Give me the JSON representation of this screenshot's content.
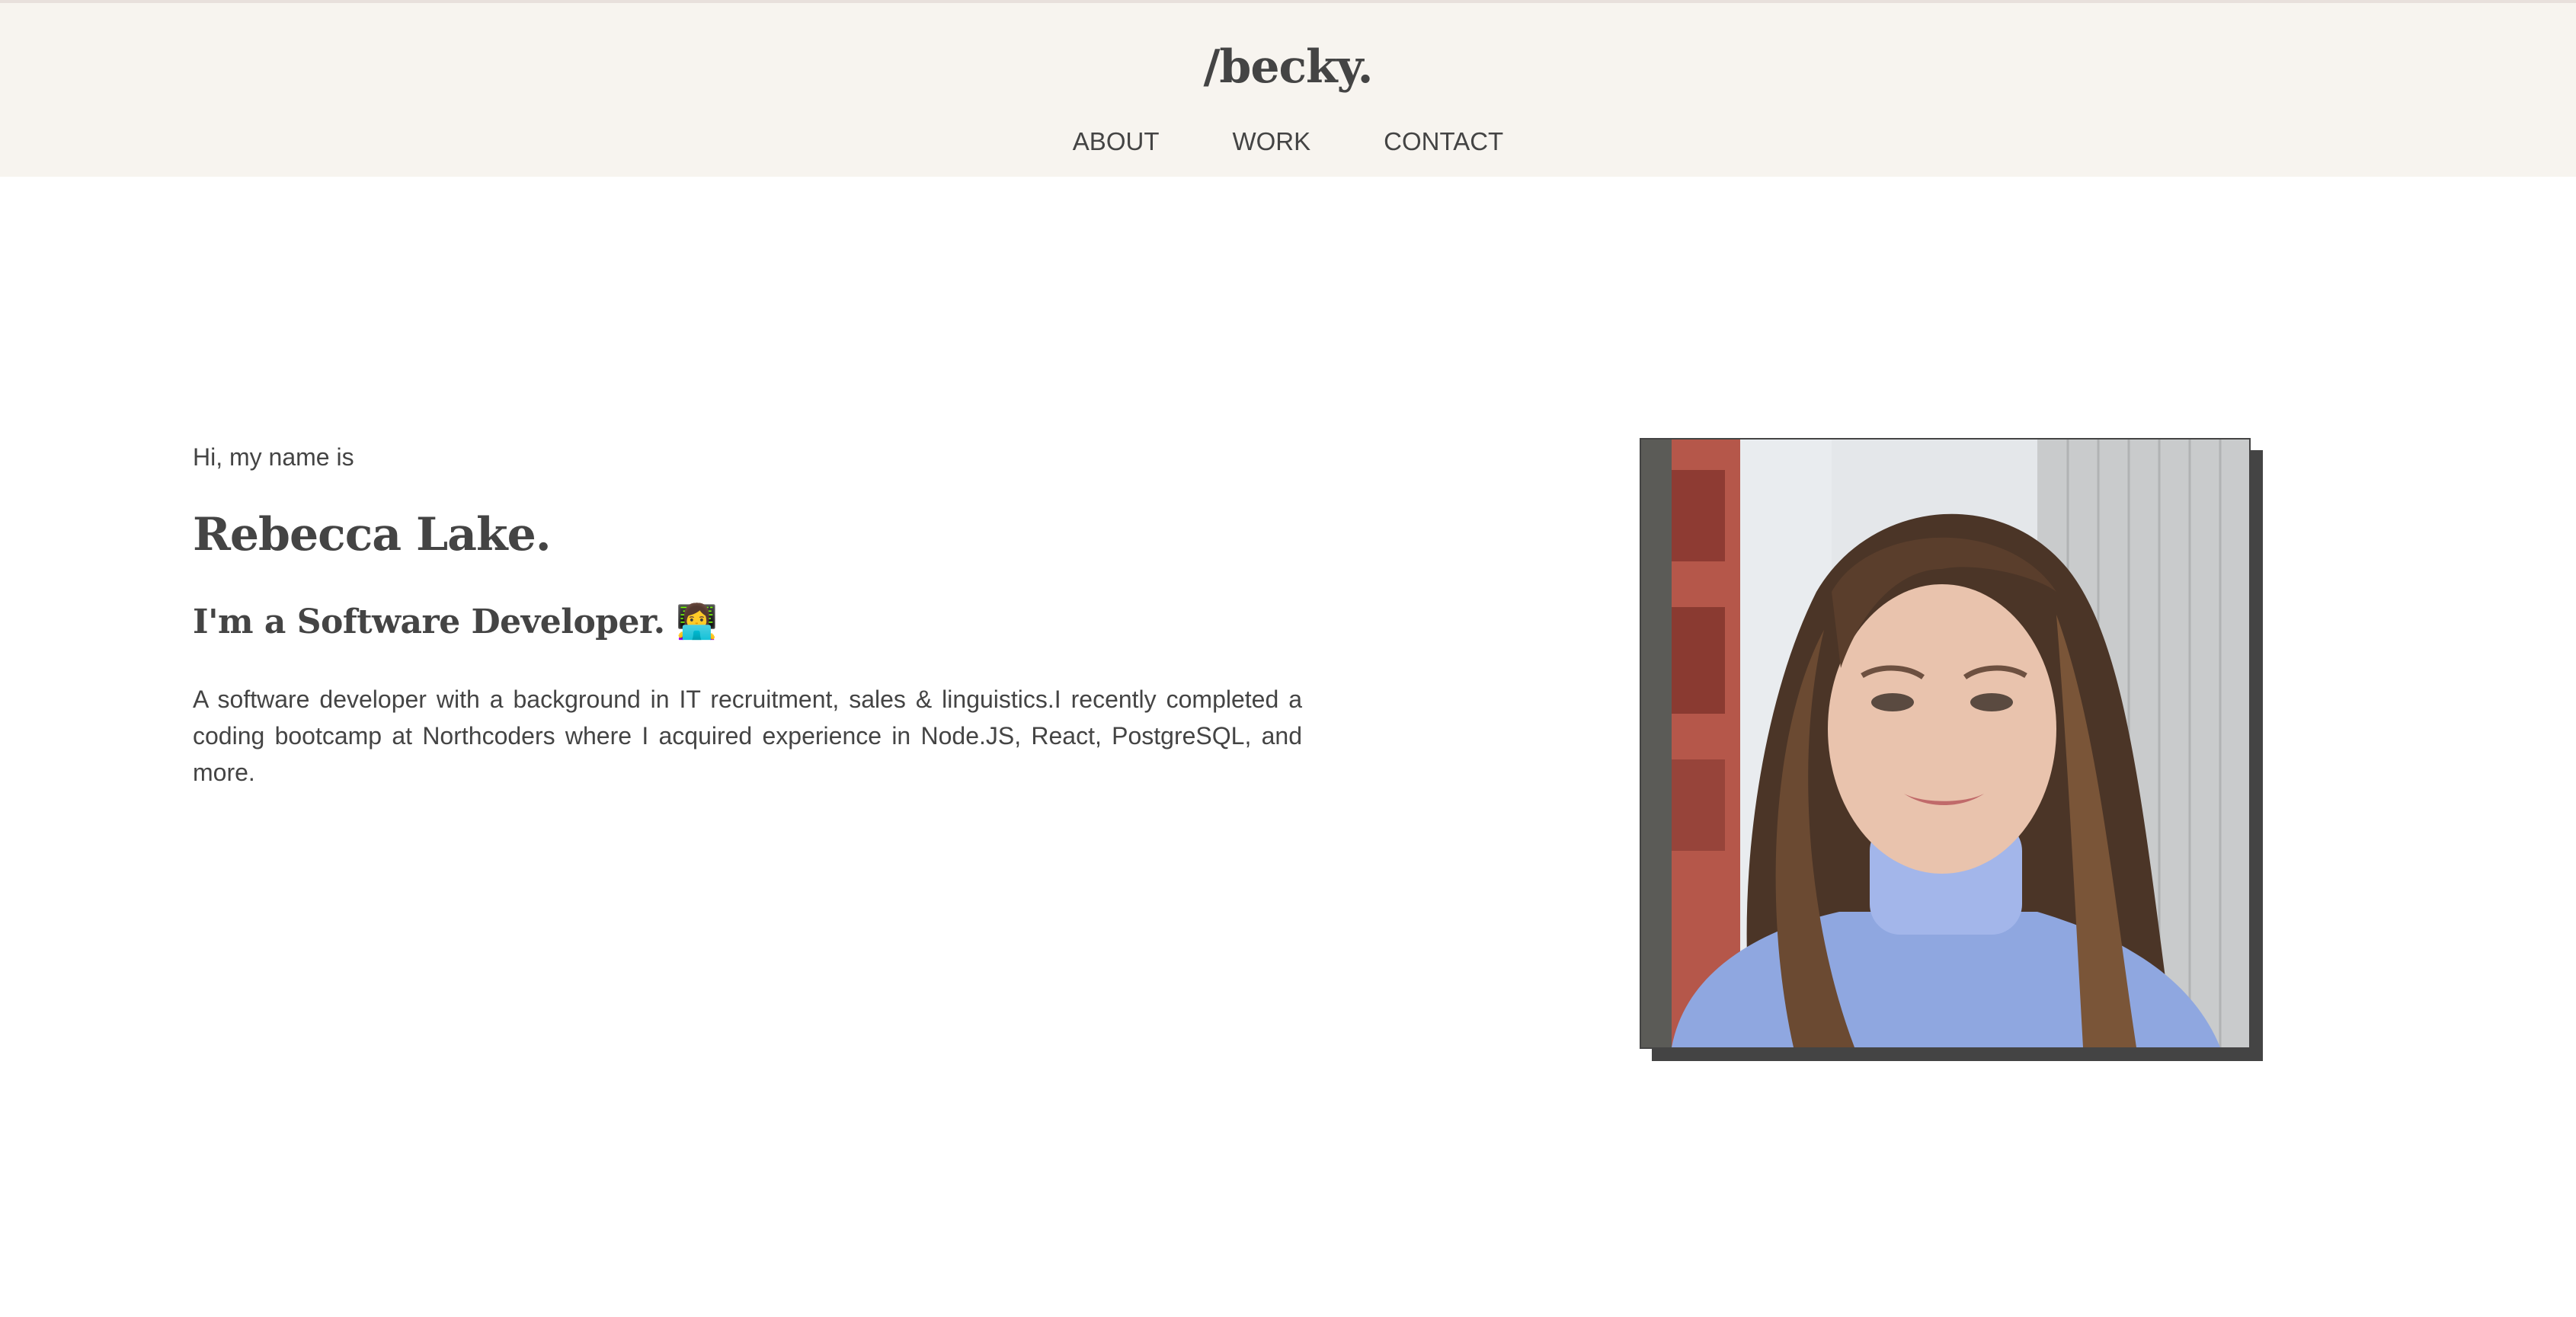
{
  "header": {
    "site_title": "/becky.",
    "nav": [
      {
        "label": "ABOUT"
      },
      {
        "label": "WORK"
      },
      {
        "label": "CONTACT"
      }
    ]
  },
  "intro": {
    "greeting": "Hi, my name is",
    "name": "Rebecca Lake.",
    "role": "I'm a Software Developer. 👩‍💻",
    "bio": "A software developer with a background in IT recruitment, sales & linguistics.I recently completed a coding bootcamp at Northcoders where I acquired experience in Node.JS, React, PostgreSQL, and more."
  },
  "colors": {
    "header_bg": "#f7f4ef",
    "text": "#444444",
    "photo_shadow": "#444444"
  }
}
